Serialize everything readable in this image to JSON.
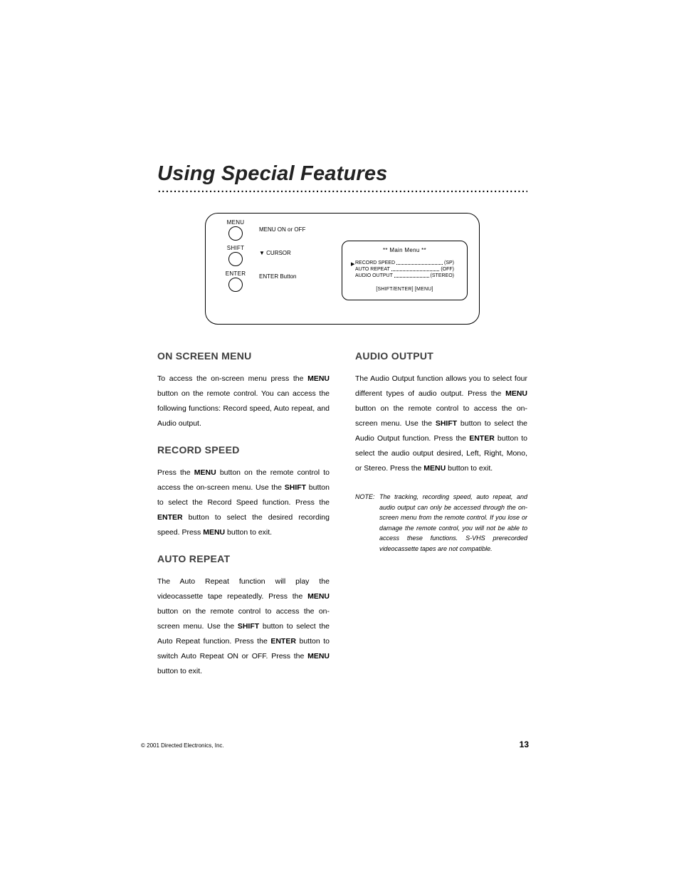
{
  "title": "Using Special Features",
  "diagram": {
    "buttons": [
      "MENU",
      "SHIFT",
      "ENTER"
    ],
    "descriptions": [
      "MENU ON or OFF",
      "▼ CURSOR",
      "ENTER Button"
    ],
    "osd": {
      "title": "** Main Menu **",
      "rows": [
        {
          "label": "RECORD SPEED",
          "value": "(SP)"
        },
        {
          "label": "AUTO REPEAT",
          "value": "(OFF)"
        },
        {
          "label": "AUDIO OUTPUT",
          "value": "(STEREO)"
        }
      ],
      "marker": "▶",
      "bottom": "[SHIFT/ENTER]   [MENU]"
    }
  },
  "left": {
    "s1": {
      "h": "ON SCREEN MENU",
      "p": {
        "t1": "To access the on-screen menu press the ",
        "b1": "MENU",
        "t2": " button on the remote control. You can access the following functions: Record speed, Auto repeat, and Audio output."
      }
    },
    "s2": {
      "h": "RECORD SPEED",
      "p": {
        "t1": "Press the ",
        "b1": "MENU",
        "t2": " button on the remote control to access the on-screen menu. Use the ",
        "b2": "SHIFT",
        "t3": " button to select the Record Speed function. Press the ",
        "b3": "ENTER",
        "t4": " button to select the desired recording speed. Press ",
        "b4": "MENU",
        "t5": " button to exit."
      }
    },
    "s3": {
      "h": "AUTO REPEAT",
      "p": {
        "t1": "The Auto Repeat function will play the videocassette tape repeatedly. Press the ",
        "b1": "MENU",
        "t2": " button on the remote control to access the on-screen menu. Use the ",
        "b2": "SHIFT",
        "t3": " button to select the Auto Repeat function. Press the ",
        "b3": "ENTER",
        "t4": " button to switch Auto Repeat ON or OFF. Press the ",
        "b4": "MENU",
        "t5": " button to exit."
      }
    }
  },
  "right": {
    "s1": {
      "h": "AUDIO OUTPUT",
      "p": {
        "t1": "The Audio Output function allows you to select four different types of audio output. Press the ",
        "b1": "MENU",
        "t2": " button on the remote control to access the on-screen menu. Use the ",
        "b2": "SHIFT",
        "t3": " button to select the Audio Output function. Press the ",
        "b3": "ENTER",
        "t4": " button to select the audio output desired, Left, Right, Mono, or Stereo. Press the ",
        "b4": "MENU",
        "t5": " button to exit."
      }
    },
    "note": {
      "label": "NOTE:",
      "text": "The tracking, recording speed, auto repeat, and audio output can only be accessed through the on- screen menu from the remote control. If you lose or damage the remote control, you will not be able to access these functions. S-VHS prerecorded videocassette tapes are not compatible."
    }
  },
  "footer": {
    "copyright": "© 2001 Directed Electronics, Inc.",
    "page": "13"
  }
}
